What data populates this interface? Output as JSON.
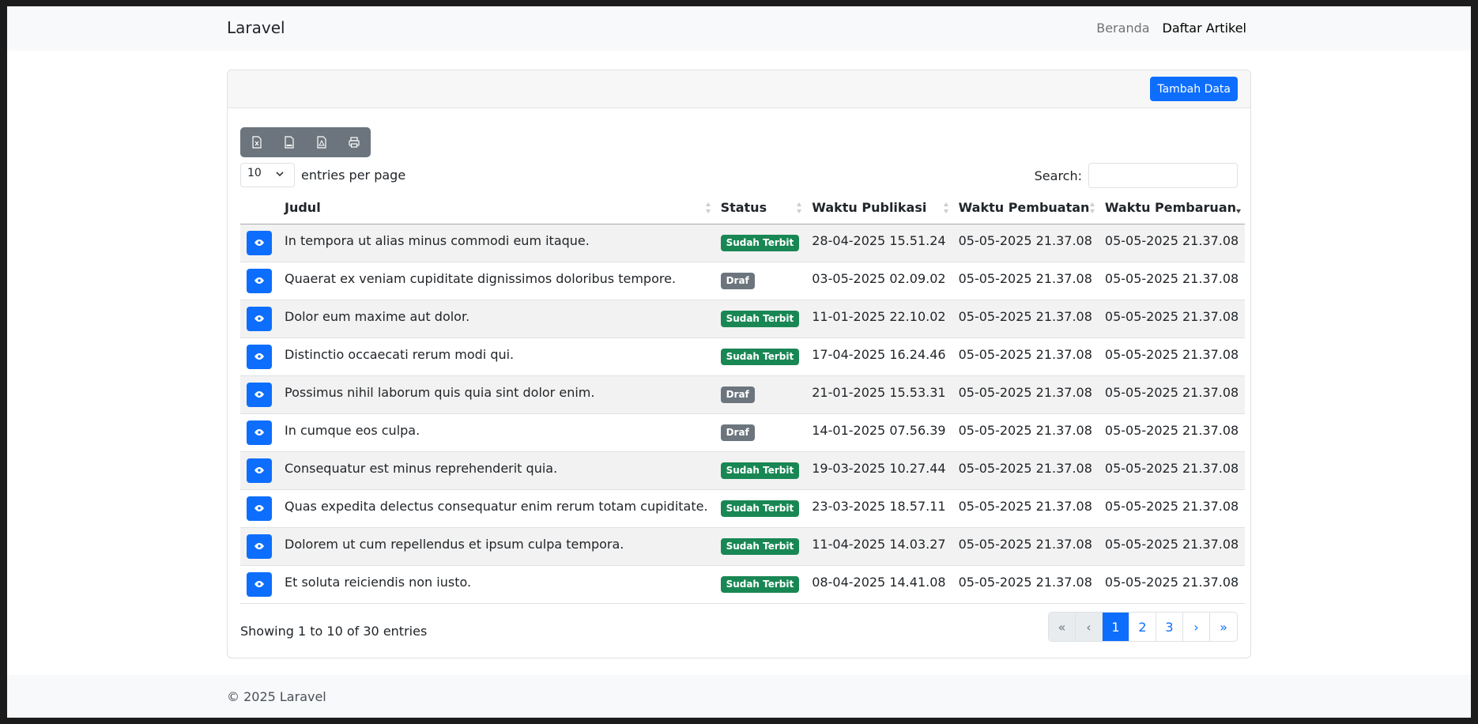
{
  "navbar": {
    "brand": "Laravel",
    "links": [
      {
        "label": "Beranda"
      },
      {
        "label": "Daftar Artikel"
      }
    ]
  },
  "card": {
    "add_button": "Tambah Data",
    "export_buttons": [
      "excel-icon",
      "csv-icon",
      "pdf-icon",
      "print-icon"
    ],
    "entries_value": "10",
    "entries_label": "entries per page",
    "search_label": "Search:",
    "search_value": ""
  },
  "table": {
    "columns": [
      "Judul",
      "Status",
      "Waktu Publikasi",
      "Waktu Pembuatan",
      "Waktu Pembaruan"
    ],
    "rows": [
      {
        "judul": "In tempora ut alias minus commodi eum itaque.",
        "status": "Sudah Terbit",
        "publikasi": "28-04-2025 15.51.24",
        "pembuatan": "05-05-2025 21.37.08",
        "pembaruan": "05-05-2025 21.37.08"
      },
      {
        "judul": "Quaerat ex veniam cupiditate dignissimos doloribus tempore.",
        "status": "Draf",
        "publikasi": "03-05-2025 02.09.02",
        "pembuatan": "05-05-2025 21.37.08",
        "pembaruan": "05-05-2025 21.37.08"
      },
      {
        "judul": "Dolor eum maxime aut dolor.",
        "status": "Sudah Terbit",
        "publikasi": "11-01-2025 22.10.02",
        "pembuatan": "05-05-2025 21.37.08",
        "pembaruan": "05-05-2025 21.37.08"
      },
      {
        "judul": "Distinctio occaecati rerum modi qui.",
        "status": "Sudah Terbit",
        "publikasi": "17-04-2025 16.24.46",
        "pembuatan": "05-05-2025 21.37.08",
        "pembaruan": "05-05-2025 21.37.08"
      },
      {
        "judul": "Possimus nihil laborum quis quia sint dolor enim.",
        "status": "Draf",
        "publikasi": "21-01-2025 15.53.31",
        "pembuatan": "05-05-2025 21.37.08",
        "pembaruan": "05-05-2025 21.37.08"
      },
      {
        "judul": "In cumque eos culpa.",
        "status": "Draf",
        "publikasi": "14-01-2025 07.56.39",
        "pembuatan": "05-05-2025 21.37.08",
        "pembaruan": "05-05-2025 21.37.08"
      },
      {
        "judul": "Consequatur est minus reprehenderit quia.",
        "status": "Sudah Terbit",
        "publikasi": "19-03-2025 10.27.44",
        "pembuatan": "05-05-2025 21.37.08",
        "pembaruan": "05-05-2025 21.37.08"
      },
      {
        "judul": "Quas expedita delectus consequatur enim rerum totam cupiditate.",
        "status": "Sudah Terbit",
        "publikasi": "23-03-2025 18.57.11",
        "pembuatan": "05-05-2025 21.37.08",
        "pembaruan": "05-05-2025 21.37.08"
      },
      {
        "judul": "Dolorem ut cum repellendus et ipsum culpa tempora.",
        "status": "Sudah Terbit",
        "publikasi": "11-04-2025 14.03.27",
        "pembuatan": "05-05-2025 21.37.08",
        "pembaruan": "05-05-2025 21.37.08"
      },
      {
        "judul": "Et soluta reiciendis non iusto.",
        "status": "Sudah Terbit",
        "publikasi": "08-04-2025 14.41.08",
        "pembuatan": "05-05-2025 21.37.08",
        "pembaruan": "05-05-2025 21.37.08"
      }
    ]
  },
  "footer_info": {
    "showing": "Showing 1 to 10 of 30 entries",
    "pager": [
      "«",
      "‹",
      "1",
      "2",
      "3",
      "›",
      "»"
    ]
  },
  "footer": {
    "copyright": "© 2025 Laravel"
  },
  "colors": {
    "primary": "#0d6efd",
    "success": "#198754",
    "secondary": "#6c757d"
  }
}
